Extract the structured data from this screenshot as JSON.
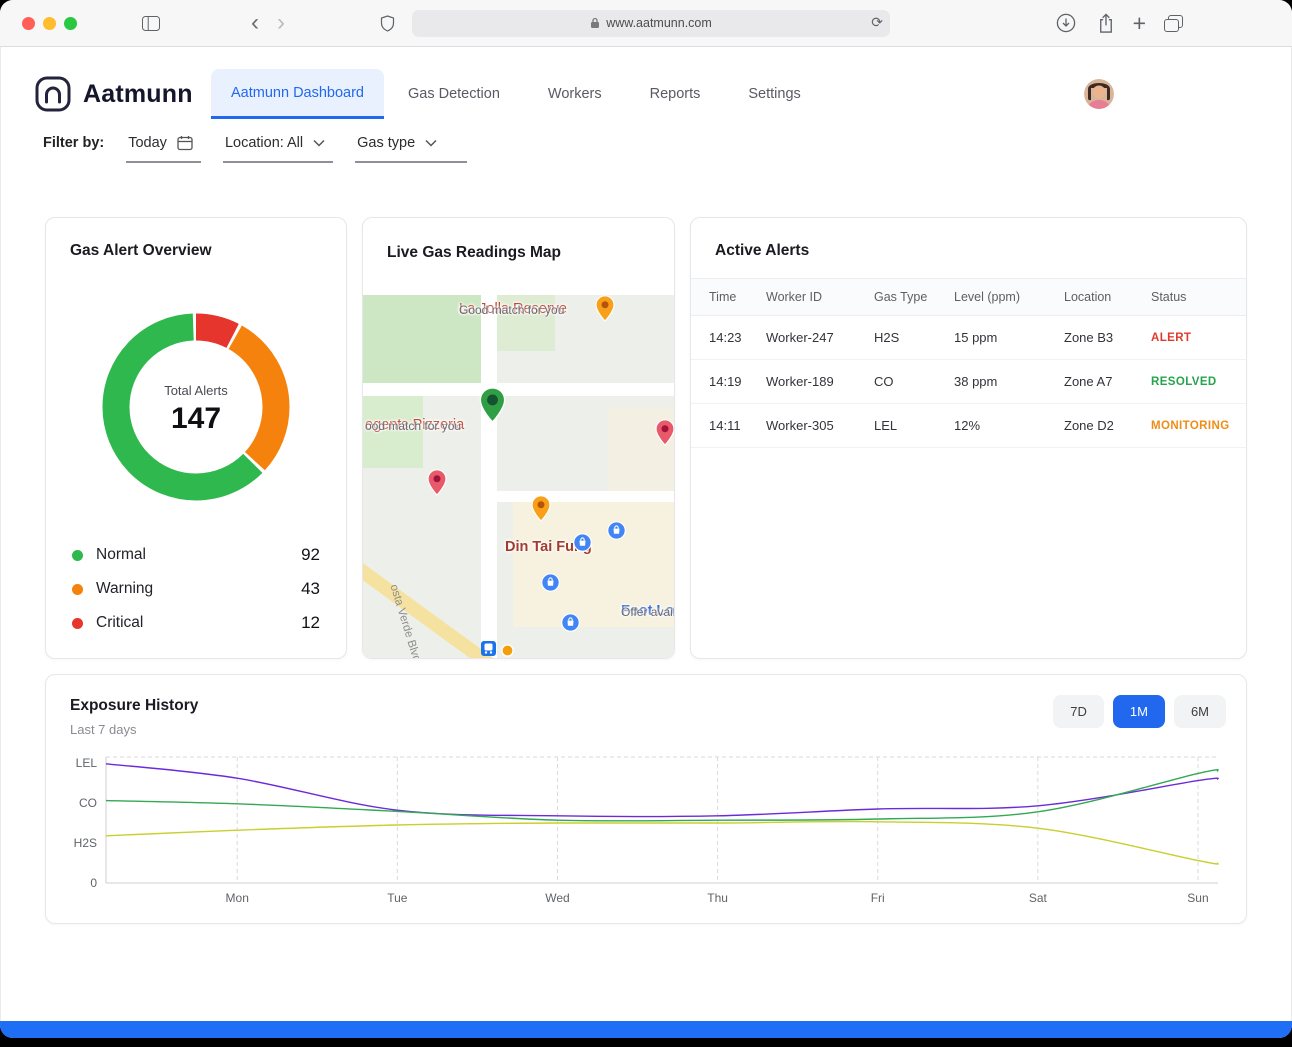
{
  "browser": {
    "url": "www.aatmunn.com",
    "icons": {
      "back": "‹",
      "forward": "›",
      "new_tab": "+",
      "reload": "⟳"
    }
  },
  "header": {
    "brand": "Aatmunn",
    "nav": [
      {
        "label": "Aatmunn Dashboard",
        "active": true
      },
      {
        "label": "Gas Detection",
        "active": false
      },
      {
        "label": "Workers",
        "active": false
      },
      {
        "label": "Reports",
        "active": false
      },
      {
        "label": "Settings",
        "active": false
      }
    ]
  },
  "filters": {
    "label": "Filter by:",
    "date": "Today",
    "location": "Location: All",
    "gas_type": "Gas type"
  },
  "overview_card": {
    "title": "Gas Alert Overview"
  },
  "map_card": {
    "title": "Live Gas Readings Map",
    "labels": {
      "reserve": {
        "name": "La Jolla Reserve",
        "sub": "Good match for you"
      },
      "pizzeria": {
        "name": "egents Pizzeria",
        "sub": "ood match for you"
      },
      "restaurant": {
        "name": "Din Tai Fung"
      },
      "store": {
        "name": "Foot Locker",
        "sub": "Offer available"
      },
      "street": "osta Verde Blvd"
    }
  },
  "alerts_card": {
    "title": "Active Alerts",
    "columns": [
      "Time",
      "Worker ID",
      "Gas Type",
      "Level (ppm)",
      "Location",
      "Status"
    ],
    "rows": [
      {
        "time": "14:23",
        "worker_id": "Worker-247",
        "gas_type": "H2S",
        "level": "15 ppm",
        "location": "Zone B3",
        "status": "ALERT",
        "status_color": "#e03a2f"
      },
      {
        "time": "14:19",
        "worker_id": "Worker-189",
        "gas_type": "CO",
        "level": "38 ppm",
        "location": "Zone A7",
        "status": "RESOLVED",
        "status_color": "#27a34c"
      },
      {
        "time": "14:11",
        "worker_id": "Worker-305",
        "gas_type": "LEL",
        "level": "12%",
        "location": "Zone D2",
        "status": "MONITORING",
        "status_color": "#ef8c17"
      }
    ]
  },
  "exposure_card": {
    "title": "Exposure History",
    "subtitle": "Last 7 days",
    "ranges": [
      {
        "label": "7D",
        "active": false
      },
      {
        "label": "1M",
        "active": true
      },
      {
        "label": "6M",
        "active": false
      }
    ]
  },
  "chart_data": [
    {
      "type": "donut",
      "title": "Gas Alert Overview",
      "center_label": "Total Alerts",
      "total": "147",
      "labels": [
        "Normal",
        "Warning",
        "Critical"
      ],
      "values": [
        92,
        43,
        12
      ],
      "colors": [
        "#2eb84d",
        "#f5820d",
        "#e5352c"
      ],
      "clockwise_from_top": [
        "Critical",
        "Warning",
        "Normal"
      ]
    },
    {
      "type": "line",
      "title": "Exposure History",
      "subtitle": "Last 7 days",
      "x_ticks": [
        "Mon",
        "Tue",
        "Wed",
        "Thu",
        "Fri",
        "Sat",
        "Sun"
      ],
      "x_tick_fracs": [
        0.118,
        0.262,
        0.406,
        0.55,
        0.694,
        0.838,
        0.982
      ],
      "y_ticks": [
        "0",
        "H2S",
        "CO",
        "LEL"
      ],
      "y_tick_values": [
        0,
        1,
        2,
        3
      ],
      "ylim": [
        0,
        3.15
      ],
      "grid": "vertical-dashed",
      "legend_position": "none",
      "x_fracs": [
        0,
        0.118,
        0.262,
        0.406,
        0.55,
        0.694,
        0.838,
        0.982,
        1.0
      ],
      "series": [
        {
          "name": "LEL",
          "color": "#6c2bd9",
          "values": [
            2.98,
            2.62,
            1.82,
            1.68,
            1.68,
            1.85,
            1.93,
            2.56,
            2.6
          ]
        },
        {
          "name": "CO",
          "color": "#34a853",
          "values": [
            2.06,
            1.98,
            1.79,
            1.57,
            1.57,
            1.6,
            1.78,
            2.74,
            2.8
          ]
        },
        {
          "name": "H2S",
          "color": "#c9cf2d",
          "values": [
            1.18,
            1.32,
            1.45,
            1.5,
            1.5,
            1.53,
            1.37,
            0.56,
            0.49
          ]
        }
      ]
    }
  ]
}
